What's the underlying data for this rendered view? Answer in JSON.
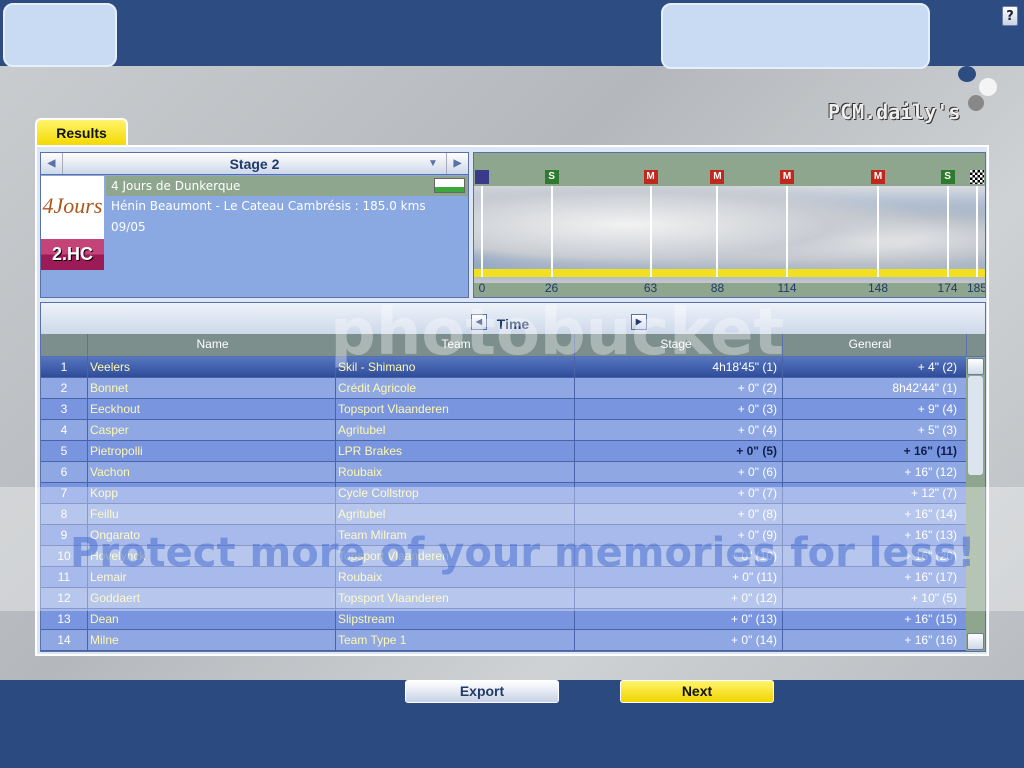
{
  "top": {
    "help_label": "?",
    "logo_text": "PCM.daily's 2008"
  },
  "tab": {
    "label": "Results"
  },
  "stage": {
    "title": "Stage 2",
    "race_name": "4 Jours de Dunkerque",
    "route": "Hénin Beaumont - Le Cateau Cambrésis : 185.0 kms",
    "date": "09/05",
    "category": "2.HC",
    "logo_text": "4Jours"
  },
  "profile": {
    "markers": [
      {
        "km": 0,
        "type": "start",
        "label": ""
      },
      {
        "km": 26,
        "type": "sprint",
        "label": "S"
      },
      {
        "km": 63,
        "type": "mountain",
        "label": "M"
      },
      {
        "km": 88,
        "type": "mountain",
        "label": "M"
      },
      {
        "km": 114,
        "type": "mountain",
        "label": "M"
      },
      {
        "km": 148,
        "type": "mountain",
        "label": "M"
      },
      {
        "km": 174,
        "type": "sprint",
        "label": "S"
      },
      {
        "km": 185,
        "type": "finish",
        "label": ""
      }
    ],
    "km_labels": [
      "0",
      "26",
      "63",
      "88",
      "114",
      "148",
      "174",
      "185"
    ],
    "colors": {
      "start": "#3a3a8a",
      "sprint": "#2e7a2e",
      "mountain": "#c0281e",
      "road": "#f0e020"
    }
  },
  "table": {
    "mode": "Time",
    "columns": [
      "",
      "Name",
      "Team",
      "Stage",
      "General"
    ],
    "rows": [
      {
        "rank": "1",
        "name": "Veelers",
        "team": "Skil - Shimano",
        "stage": "4h18'45\" (1)",
        "general": "+ 4\" (2)"
      },
      {
        "rank": "2",
        "name": "Bonnet",
        "team": "Crédit Agricole",
        "stage": "+ 0\" (2)",
        "general": "8h42'44\" (1)"
      },
      {
        "rank": "3",
        "name": "Eeckhout",
        "team": "Topsport Vlaanderen",
        "stage": "+ 0\" (3)",
        "general": "+ 9\" (4)"
      },
      {
        "rank": "4",
        "name": "Casper",
        "team": "Agritubel",
        "stage": "+ 0\" (4)",
        "general": "+ 5\" (3)"
      },
      {
        "rank": "5",
        "name": "Pietropolli",
        "team": "LPR Brakes",
        "stage": "+ 0\" (5)",
        "general": "+ 16\" (11)"
      },
      {
        "rank": "6",
        "name": "Vachon",
        "team": "Roubaix",
        "stage": "+ 0\" (6)",
        "general": "+ 16\" (12)"
      },
      {
        "rank": "7",
        "name": "Kopp",
        "team": "Cycle Collstrop",
        "stage": "+ 0\" (7)",
        "general": "+ 12\" (7)"
      },
      {
        "rank": "8",
        "name": "Feillu",
        "team": "Agritubel",
        "stage": "+ 0\" (8)",
        "general": "+ 16\" (14)"
      },
      {
        "rank": "9",
        "name": "Ongarato",
        "team": "Team Milram",
        "stage": "+ 0\" (9)",
        "general": "+ 16\" (13)"
      },
      {
        "rank": "10",
        "name": "Hovelynck",
        "team": "Topsport Vlaanderen",
        "stage": "+ 0\" (10)",
        "general": "+ 16\" (20)"
      },
      {
        "rank": "11",
        "name": "Lemair",
        "team": "Roubaix",
        "stage": "+ 0\" (11)",
        "general": "+ 16\" (17)"
      },
      {
        "rank": "12",
        "name": "Goddaert",
        "team": "Topsport Vlaanderen",
        "stage": "+ 0\" (12)",
        "general": "+ 10\" (5)"
      },
      {
        "rank": "13",
        "name": "Dean",
        "team": "Slipstream",
        "stage": "+ 0\" (13)",
        "general": "+ 16\" (15)"
      },
      {
        "rank": "14",
        "name": "Milne",
        "team": "Team Type 1",
        "stage": "+ 0\" (14)",
        "general": "+ 16\" (16)"
      }
    ],
    "selected_rank": "1",
    "bold_rank": "5"
  },
  "buttons": {
    "export": "Export",
    "next": "Next"
  },
  "watermark": {
    "brand": "photobucket",
    "slogan": "Protect more of your memories for less!"
  }
}
